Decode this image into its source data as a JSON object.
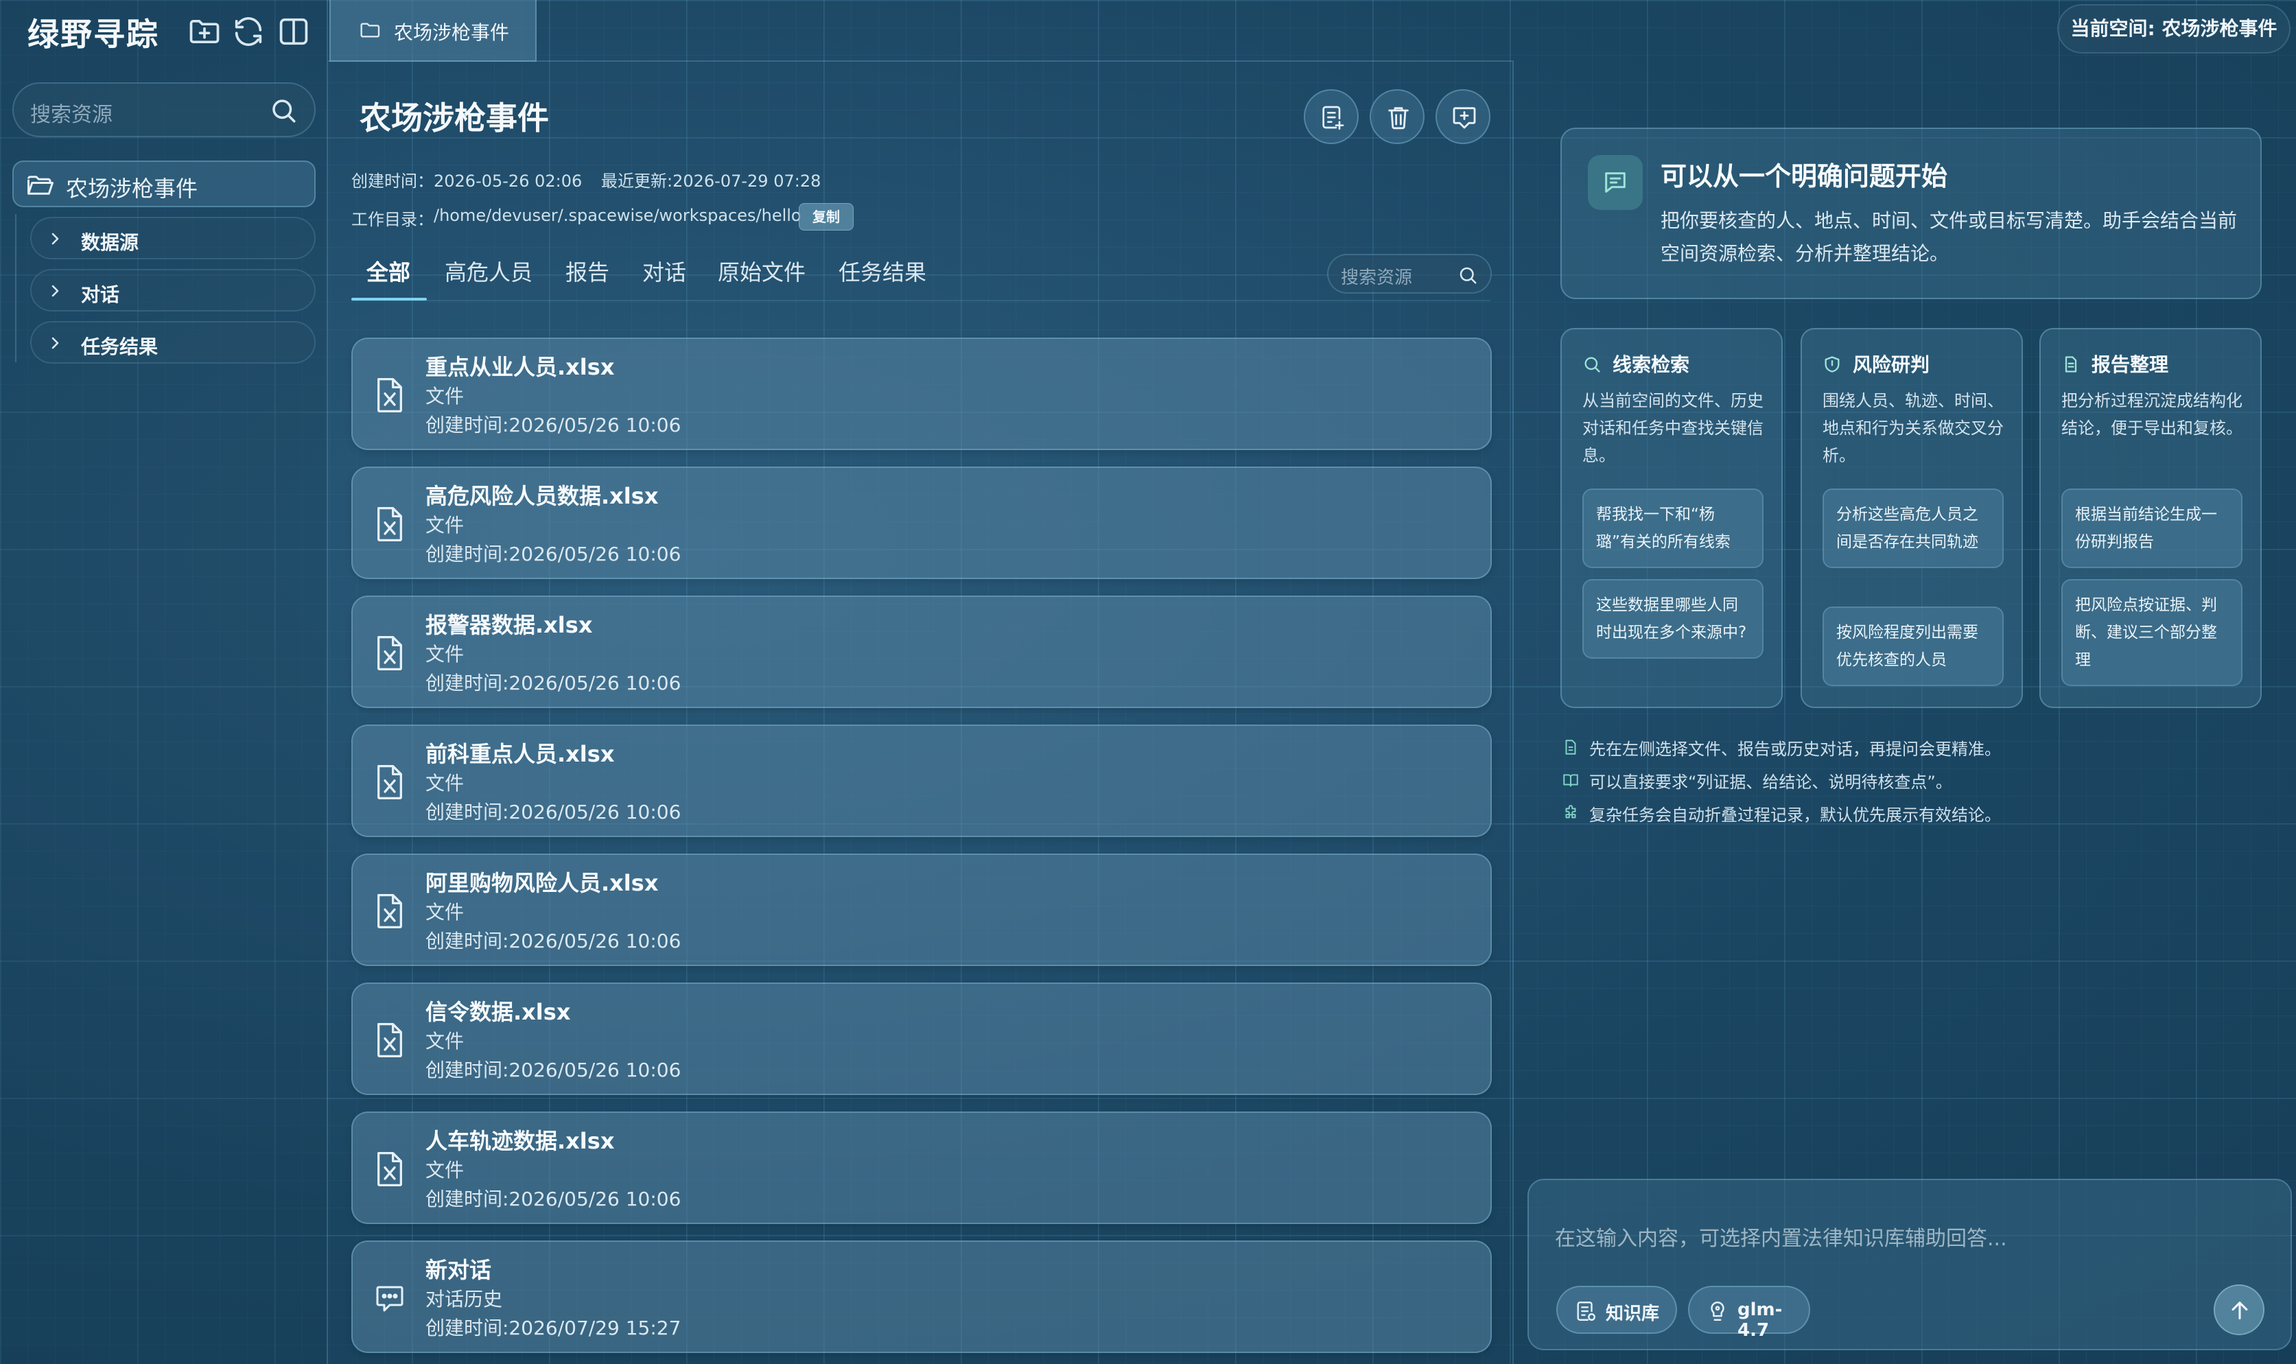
{
  "app": {
    "title": "绿野寻踪"
  },
  "sidebar": {
    "search_placeholder": "搜索资源",
    "folder": "农场涉枪事件",
    "items": [
      {
        "label": "数据源"
      },
      {
        "label": "对话"
      },
      {
        "label": "任务结果"
      }
    ]
  },
  "tabbar": {
    "tab_label": "农场涉枪事件"
  },
  "main": {
    "title": "农场涉枪事件",
    "created": "创建时间：2026-05-26 02:06",
    "updated": "最近更新:2026-07-29 07:28",
    "workdir_label": "工作目录：",
    "workdir_path": "/home/devuser/.spacewise/workspaces/hello",
    "copy_label": "复制",
    "tabs": [
      {
        "label": "全部",
        "active": true
      },
      {
        "label": "高危人员"
      },
      {
        "label": "报告"
      },
      {
        "label": "对话"
      },
      {
        "label": "原始文件"
      },
      {
        "label": "任务结果"
      }
    ],
    "search_placeholder": "搜索资源",
    "files": [
      {
        "name": "重点从业人员.xlsx",
        "type": "文件",
        "time": "创建时间:2026/05/26 10:06",
        "icon": "excel-file-icon"
      },
      {
        "name": "高危风险人员数据.xlsx",
        "type": "文件",
        "time": "创建时间:2026/05/26 10:06",
        "icon": "excel-file-icon"
      },
      {
        "name": "报警器数据.xlsx",
        "type": "文件",
        "time": "创建时间:2026/05/26 10:06",
        "icon": "excel-file-icon"
      },
      {
        "name": "前科重点人员.xlsx",
        "type": "文件",
        "time": "创建时间:2026/05/26 10:06",
        "icon": "excel-file-icon"
      },
      {
        "name": "阿里购物风险人员.xlsx",
        "type": "文件",
        "time": "创建时间:2026/05/26 10:06",
        "icon": "excel-file-icon"
      },
      {
        "name": "信令数据.xlsx",
        "type": "文件",
        "time": "创建时间:2026/05/26 10:06",
        "icon": "excel-file-icon"
      },
      {
        "name": "人车轨迹数据.xlsx",
        "type": "文件",
        "time": "创建时间:2026/05/26 10:06",
        "icon": "excel-file-icon"
      },
      {
        "name": "新对话",
        "type": "对话历史",
        "time": "创建时间:2026/07/29 15:27",
        "icon": "chat-bubble-icon"
      }
    ]
  },
  "right": {
    "space_label": "当前空间: 农场涉枪事件",
    "intro": {
      "title": "可以从一个明确问题开始",
      "desc": "把你要核查的人、地点、时间、文件或目标写清楚。助手会结合当前空间资源检索、分析并整理结论。"
    },
    "features": [
      {
        "title": "线索检索",
        "desc": "从当前空间的文件、历史对话和任务中查找关键信息。",
        "suggestions": [
          "帮我找一下和“杨璐”有关的所有线索",
          "这些数据里哪些人同时出现在多个来源中?"
        ]
      },
      {
        "title": "风险研判",
        "desc": "围绕人员、轨迹、时间、地点和行为关系做交叉分析。",
        "suggestions": [
          "分析这些高危人员之间是否存在共同轨迹",
          "按风险程度列出需要优先核查的人员"
        ]
      },
      {
        "title": "报告整理",
        "desc": "把分析过程沉淀成结构化结论，便于导出和复核。",
        "suggestions": [
          "根据当前结论生成一份研判报告",
          "把风险点按证据、判断、建议三个部分整理"
        ]
      }
    ],
    "tips": [
      "先在左侧选择文件、报告或历史对话，再提问会更精准。",
      "可以直接要求“列证据、给结论、说明待核查点”。",
      "复杂任务会自动折叠过程记录，默认优先展示有效结论。"
    ],
    "input_placeholder": "在这输入内容，可选择内置法律知识库辅助回答...",
    "chip_knowledge": "知识库",
    "chip_model": "glm-4.7"
  },
  "colors": {
    "accent": "#7fd4f0",
    "teal_icon": "#9ee3d8"
  }
}
